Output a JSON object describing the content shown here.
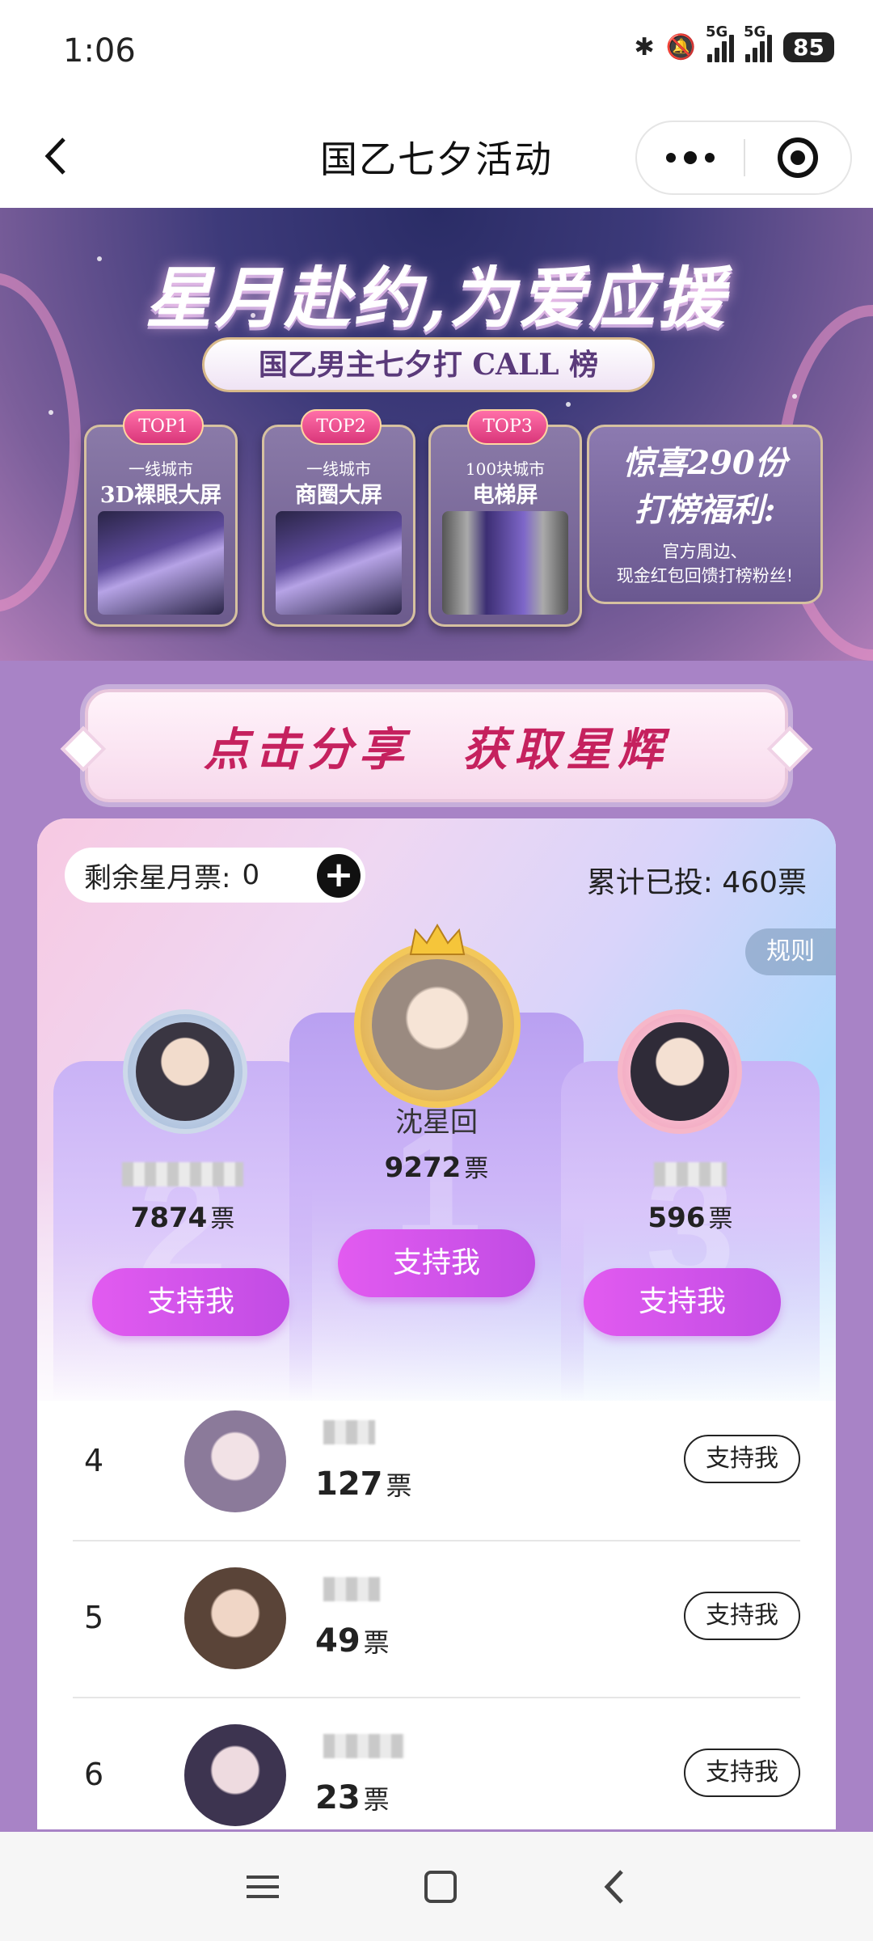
{
  "status_bar": {
    "time": "1:06",
    "net1": "5G",
    "net2": "5G",
    "battery": "85"
  },
  "header": {
    "title": "国乙七夕活动"
  },
  "banner": {
    "title": "星月赴约,为爱应援",
    "subtitle": "国乙男主七夕打 CALL 榜",
    "prizes": [
      {
        "badge": "TOP1",
        "line1": "一线城市",
        "line2": "3D裸眼大屏"
      },
      {
        "badge": "TOP2",
        "line1": "一线城市",
        "line2": "商圈大屏"
      },
      {
        "badge": "TOP3",
        "line1": "100块城市",
        "line2": "电梯屏"
      }
    ],
    "bonus": {
      "line1": "惊喜290份",
      "line2": "打榜福利:",
      "line3": "官方周边、",
      "line4": "现金红包回馈打榜粉丝!"
    }
  },
  "share_banner": {
    "text": "点击分享　获取星辉"
  },
  "vote_panel": {
    "remaining_label": "剩余星月票:",
    "remaining_value": "0",
    "total_label": "累计已投: 460票",
    "rules_label": "规则"
  },
  "podium": [
    {
      "rank": "1",
      "name": "沈星回",
      "votes": "9272",
      "unit": "票",
      "button": "支持我"
    },
    {
      "rank": "2",
      "name": "",
      "votes": "7874",
      "unit": "票",
      "button": "支持我"
    },
    {
      "rank": "3",
      "name": "",
      "votes": "596",
      "unit": "票",
      "button": "支持我"
    }
  ],
  "ranking_list": [
    {
      "rank": "4",
      "votes": "127",
      "unit": "票",
      "button": "支持我"
    },
    {
      "rank": "5",
      "votes": "49",
      "unit": "票",
      "button": "支持我"
    },
    {
      "rank": "6",
      "votes": "23",
      "unit": "票",
      "button": "支持我"
    }
  ],
  "colors": {
    "accent_purple": "#c14ce4",
    "section_bg": "#a883c6",
    "share_text": "#c5215e"
  }
}
